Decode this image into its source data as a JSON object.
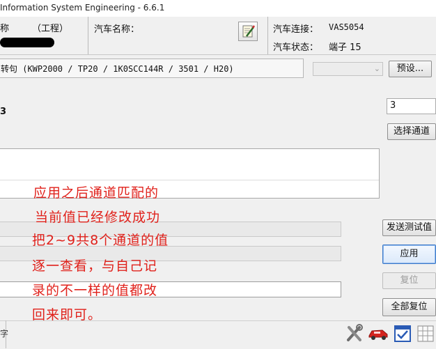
{
  "window": {
    "title": "Information System Engineering - 6.6.1"
  },
  "info": {
    "left_label": "称",
    "left_suffix": "（工程）",
    "vehicle_name_label": "汽车名称：",
    "connection_label": "汽车连接：",
    "connection_value": "VAS5054",
    "status_label": "汽车状态：",
    "status_value": "端子 15"
  },
  "protocol": {
    "text": "转句  (KWP2000 / TP20 / 1K0SCC144R   / 3501 / H20)"
  },
  "preset_button": "预设...",
  "channel": {
    "left_value": "3",
    "input_value": "3",
    "select_button": "选择通道"
  },
  "buttons": {
    "send_test": "发送测试值",
    "apply": "应用",
    "reset": "复位",
    "reset_all": "全部复位"
  },
  "annotation": {
    "lines": [
      "应用之后通道匹配的",
      "当前值已经修改成功",
      "把2~9共8个通道的值",
      "逐一查看，与自己记",
      "录的不一样的值都改",
      "回来即可。"
    ]
  },
  "statusbar": {
    "text": "字"
  },
  "icons": [
    "tools-icon",
    "car-icon",
    "checkbox-icon",
    "grid-icon"
  ]
}
